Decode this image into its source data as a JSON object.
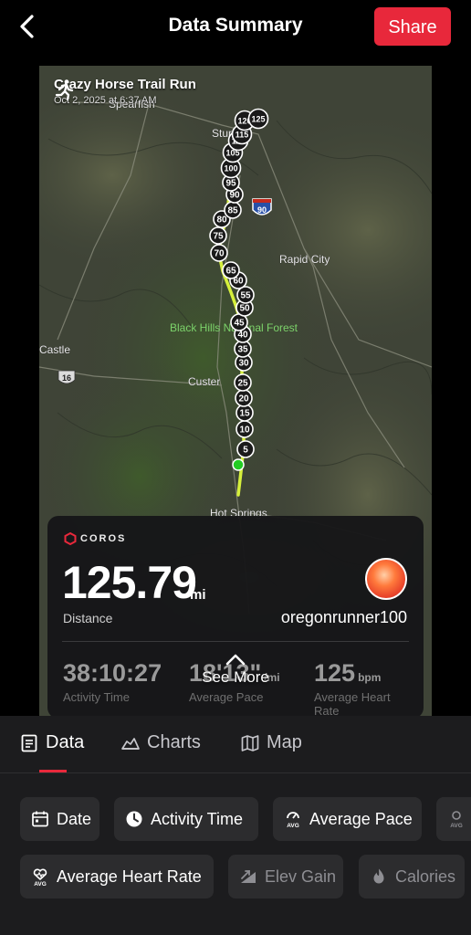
{
  "header": {
    "title": "Data Summary",
    "share_label": "Share"
  },
  "map": {
    "run_title": "Crazy Horse Trail Run",
    "run_date": "Oct 2, 2025 at 6:37 AM",
    "places": {
      "spearfish": "Spearfish",
      "sturgis": "Sturgis",
      "rapid_city": "Rapid City",
      "black_hills": "Black Hills National Forest",
      "custer": "Custer",
      "hot_springs": "Hot Springs",
      "castle": "Castle",
      "i90": "90",
      "us16": "16"
    },
    "markers": [
      "5",
      "10",
      "15",
      "20",
      "25",
      "30",
      "35",
      "40",
      "45",
      "50",
      "55",
      "60",
      "65",
      "70",
      "75",
      "80",
      "85",
      "90",
      "95",
      "100",
      "105",
      "110",
      "115",
      "120",
      "125"
    ]
  },
  "card": {
    "brand": "COROS",
    "distance_value": "125.79",
    "distance_unit": "mi",
    "distance_label": "Distance",
    "username": "oregonrunner100",
    "stats": [
      {
        "value": "38:10:27",
        "unit": "",
        "label": "Activity Time"
      },
      {
        "value": "18'13\"",
        "unit": "/mi",
        "label": "Average Pace"
      },
      {
        "value": "125",
        "unit": "bpm",
        "label": "Average Heart Rate"
      }
    ],
    "see_more": "See More"
  },
  "tabs": [
    {
      "label": "Data",
      "icon": "document-icon",
      "active": true
    },
    {
      "label": "Charts",
      "icon": "elevation-chart-icon",
      "active": false
    },
    {
      "label": "Map",
      "icon": "map-icon",
      "active": false
    }
  ],
  "chips": [
    {
      "label": "Date",
      "icon": "calendar-icon"
    },
    {
      "label": "Activity Time",
      "icon": "clock-icon"
    },
    {
      "label": "Average Pace",
      "icon": "avg-pace-icon"
    },
    {
      "label": "Average Heart Rate",
      "icon": "avg-heart-rate-icon"
    },
    {
      "label": "Elev Gain",
      "icon": "elevation-gain-icon"
    },
    {
      "label": "Calories",
      "icon": "flame-icon"
    }
  ],
  "colors": {
    "accent": "#e8283b",
    "route": "#d6f03c",
    "start": "#22cc22"
  }
}
